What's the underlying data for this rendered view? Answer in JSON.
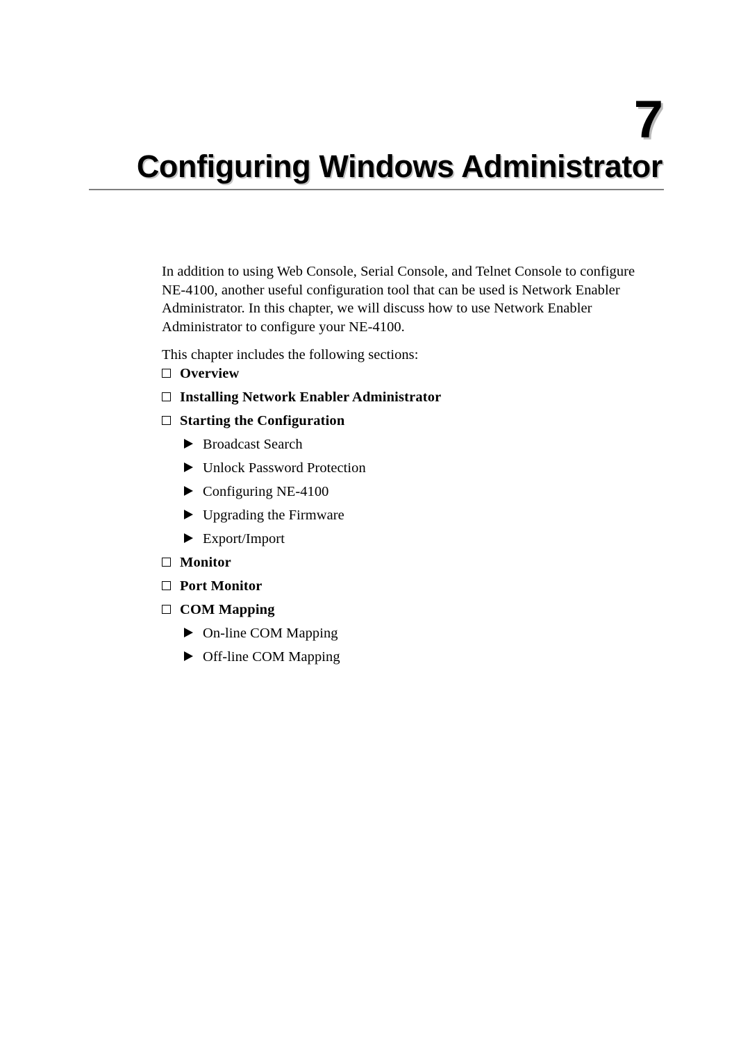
{
  "chapter": {
    "number": "7",
    "title": "Configuring Windows Administrator"
  },
  "body": {
    "paragraph_1": "In addition to using Web Console, Serial Console, and Telnet Console to configure NE-4100, another useful configuration tool that can be used is Network Enabler Administrator. In this chapter, we will discuss how to use Network Enabler Administrator to configure your NE-4100.",
    "paragraph_2": "This chapter includes the following sections:"
  },
  "sections": [
    {
      "level": 1,
      "bullet": "square-bullet-icon",
      "label": "Overview"
    },
    {
      "level": 1,
      "bullet": "square-bullet-icon",
      "label": "Installing Network Enabler Administrator"
    },
    {
      "level": 1,
      "bullet": "square-bullet-icon",
      "label": "Starting the Configuration"
    },
    {
      "level": 2,
      "bullet": "arrow-bullet-icon",
      "label": "Broadcast Search"
    },
    {
      "level": 2,
      "bullet": "arrow-bullet-icon",
      "label": "Unlock Password Protection"
    },
    {
      "level": 2,
      "bullet": "arrow-bullet-icon",
      "label": "Configuring NE-4100"
    },
    {
      "level": 2,
      "bullet": "arrow-bullet-icon",
      "label": "Upgrading the Firmware"
    },
    {
      "level": 2,
      "bullet": "arrow-bullet-icon",
      "label": "Export/Import"
    },
    {
      "level": 1,
      "bullet": "square-bullet-icon",
      "label": "Monitor"
    },
    {
      "level": 1,
      "bullet": "square-bullet-icon",
      "label": "Port Monitor"
    },
    {
      "level": 1,
      "bullet": "square-bullet-icon",
      "label": "COM Mapping"
    },
    {
      "level": 2,
      "bullet": "arrow-bullet-icon",
      "label": "On-line COM Mapping"
    },
    {
      "level": 2,
      "bullet": "arrow-bullet-icon",
      "label": "Off-line COM Mapping"
    }
  ],
  "colors": {
    "text": "#000000",
    "rule": "#7e7e7e",
    "title_shadow": "#c4c4c4",
    "page_background": "#ffffff"
  }
}
